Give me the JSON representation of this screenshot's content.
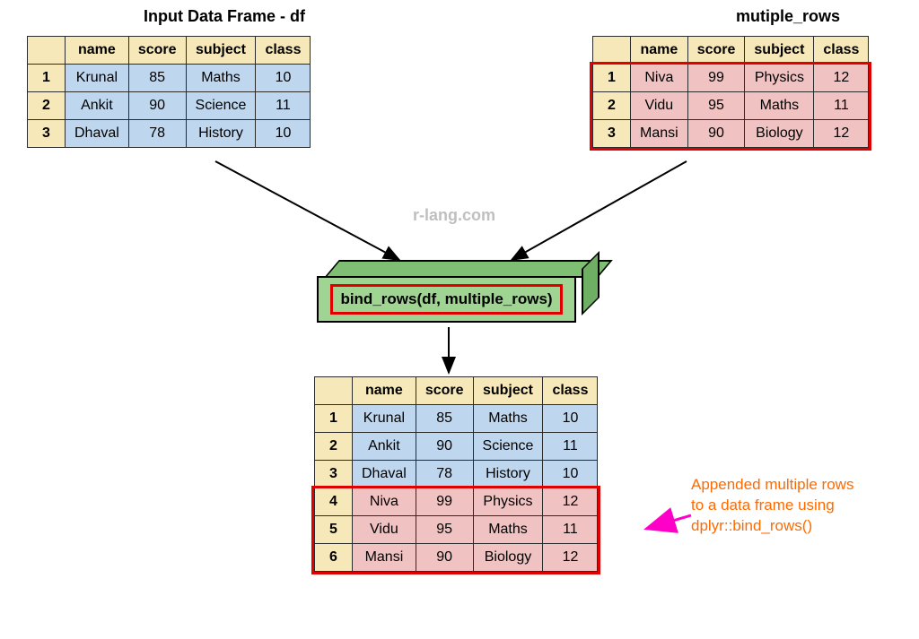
{
  "titles": {
    "df": "Input Data Frame - df",
    "mr": "mutiple_rows"
  },
  "headers": [
    "name",
    "score",
    "subject",
    "class"
  ],
  "df_rows": [
    {
      "idx": "1",
      "name": "Krunal",
      "score": "85",
      "subject": "Maths",
      "class": "10"
    },
    {
      "idx": "2",
      "name": "Ankit",
      "score": "90",
      "subject": "Science",
      "class": "11"
    },
    {
      "idx": "3",
      "name": "Dhaval",
      "score": "78",
      "subject": "History",
      "class": "10"
    }
  ],
  "mr_rows": [
    {
      "idx": "1",
      "name": "Niva",
      "score": "99",
      "subject": "Physics",
      "class": "12"
    },
    {
      "idx": "2",
      "name": "Vidu",
      "score": "95",
      "subject": "Maths",
      "class": "11"
    },
    {
      "idx": "3",
      "name": "Mansi",
      "score": "90",
      "subject": "Biology",
      "class": "12"
    }
  ],
  "result_rows": [
    {
      "idx": "1",
      "name": "Krunal",
      "score": "85",
      "subject": "Maths",
      "class": "10",
      "kind": "blue"
    },
    {
      "idx": "2",
      "name": "Ankit",
      "score": "90",
      "subject": "Science",
      "class": "11",
      "kind": "blue"
    },
    {
      "idx": "3",
      "name": "Dhaval",
      "score": "78",
      "subject": "History",
      "class": "10",
      "kind": "blue"
    },
    {
      "idx": "4",
      "name": "Niva",
      "score": "99",
      "subject": "Physics",
      "class": "12",
      "kind": "pink"
    },
    {
      "idx": "5",
      "name": "Vidu",
      "score": "95",
      "subject": "Maths",
      "class": "11",
      "kind": "pink"
    },
    {
      "idx": "6",
      "name": "Mansi",
      "score": "90",
      "subject": "Biology",
      "class": "12",
      "kind": "pink"
    }
  ],
  "func_call": "bind_rows(df, multiple_rows)",
  "watermark": "r-lang.com",
  "annotation_lines": [
    "Appended multiple rows",
    "to a data frame using",
    "dplyr::bind_rows()"
  ],
  "chart_data": {
    "type": "table",
    "operation": "bind_rows",
    "inputs": {
      "df": [
        {
          "name": "Krunal",
          "score": 85,
          "subject": "Maths",
          "class": 10
        },
        {
          "name": "Ankit",
          "score": 90,
          "subject": "Science",
          "class": 11
        },
        {
          "name": "Dhaval",
          "score": 78,
          "subject": "History",
          "class": 10
        }
      ],
      "multiple_rows": [
        {
          "name": "Niva",
          "score": 99,
          "subject": "Physics",
          "class": 12
        },
        {
          "name": "Vidu",
          "score": 95,
          "subject": "Maths",
          "class": 11
        },
        {
          "name": "Mansi",
          "score": 90,
          "subject": "Biology",
          "class": 12
        }
      ]
    },
    "output": [
      {
        "name": "Krunal",
        "score": 85,
        "subject": "Maths",
        "class": 10
      },
      {
        "name": "Ankit",
        "score": 90,
        "subject": "Science",
        "class": 11
      },
      {
        "name": "Dhaval",
        "score": 78,
        "subject": "History",
        "class": 10
      },
      {
        "name": "Niva",
        "score": 99,
        "subject": "Physics",
        "class": 12
      },
      {
        "name": "Vidu",
        "score": 95,
        "subject": "Maths",
        "class": 11
      },
      {
        "name": "Mansi",
        "score": 90,
        "subject": "Biology",
        "class": 12
      }
    ]
  }
}
